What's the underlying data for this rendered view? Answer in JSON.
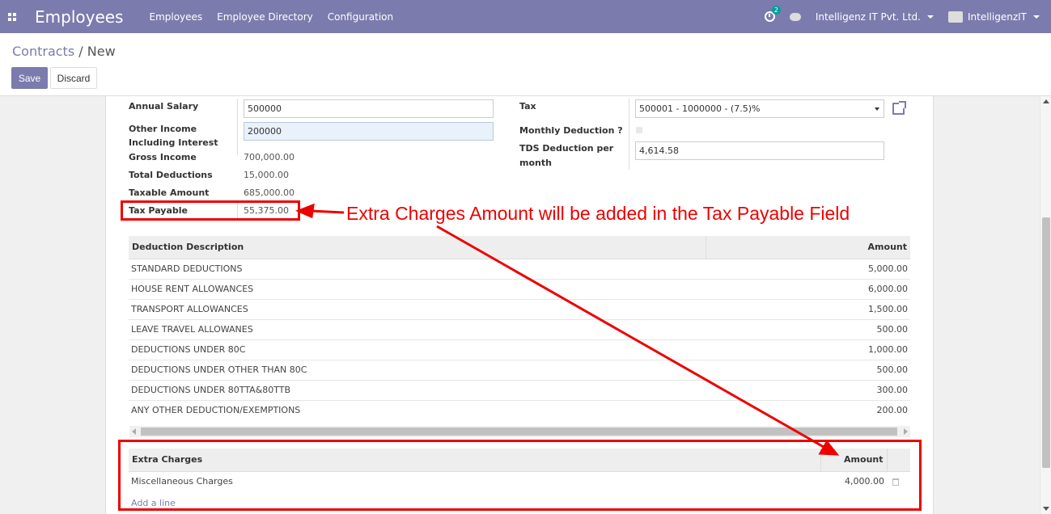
{
  "navbar": {
    "app_title": "Employees",
    "menu": [
      "Employees",
      "Employee Directory",
      "Configuration"
    ],
    "activity_count": "2",
    "company": "Intelligenz IT Pvt. Ltd.",
    "user": "IntelligenzIT"
  },
  "breadcrumb": {
    "parent": "Contracts",
    "separator": "/",
    "current": "New"
  },
  "buttons": {
    "save": "Save",
    "discard": "Discard"
  },
  "form": {
    "annual_salary_label": "Annual Salary",
    "annual_salary_value": "500000",
    "other_income_label_1": "Other Income",
    "other_income_label_2": "Including Interest",
    "other_income_value": "200000",
    "gross_income_label": "Gross Income",
    "gross_income_value": "700,000.00",
    "total_deductions_label": "Total Deductions",
    "total_deductions_value": "15,000.00",
    "taxable_amount_label": "Taxable Amount",
    "taxable_amount_value": "685,000.00",
    "tax_payable_label": "Tax Payable",
    "tax_payable_value": "55,375.00",
    "tax_label": "Tax",
    "tax_value": "500001 - 1000000 - (7.5)%",
    "monthly_deduction_label": "Monthly Deduction ?",
    "tds_label_1": "TDS Deduction per",
    "tds_label_2": "month",
    "tds_value": "4,614.58"
  },
  "deductions": {
    "headers": {
      "description": "Deduction Description",
      "amount": "Amount"
    },
    "rows": [
      {
        "description": "STANDARD DEDUCTIONS",
        "amount": "5,000.00"
      },
      {
        "description": "HOUSE RENT ALLOWANCES",
        "amount": "6,000.00"
      },
      {
        "description": "TRANSPORT ALLOWANCES",
        "amount": "1,500.00"
      },
      {
        "description": "LEAVE TRAVEL ALLOWANES",
        "amount": "500.00"
      },
      {
        "description": "DEDUCTIONS UNDER 80C",
        "amount": "1,000.00"
      },
      {
        "description": "DEDUCTIONS UNDER OTHER THAN 80C",
        "amount": "500.00"
      },
      {
        "description": "DEDUCTIONS UNDER 80TTA&80TTB",
        "amount": "300.00"
      },
      {
        "description": "ANY OTHER DEDUCTION/EXEMPTIONS",
        "amount": "200.00"
      }
    ]
  },
  "extra_charges": {
    "headers": {
      "description": "Extra Charges",
      "amount": "Amount"
    },
    "rows": [
      {
        "description": "Miscellaneous Charges",
        "amount": "4,000.00"
      }
    ],
    "add_line": "Add a line"
  },
  "annotation": {
    "text": "Extra Charges Amount will be added in the Tax Payable Field",
    "color": "#e00000"
  },
  "colors": {
    "brand": "#7c7bad",
    "annotation": "#e00000"
  }
}
